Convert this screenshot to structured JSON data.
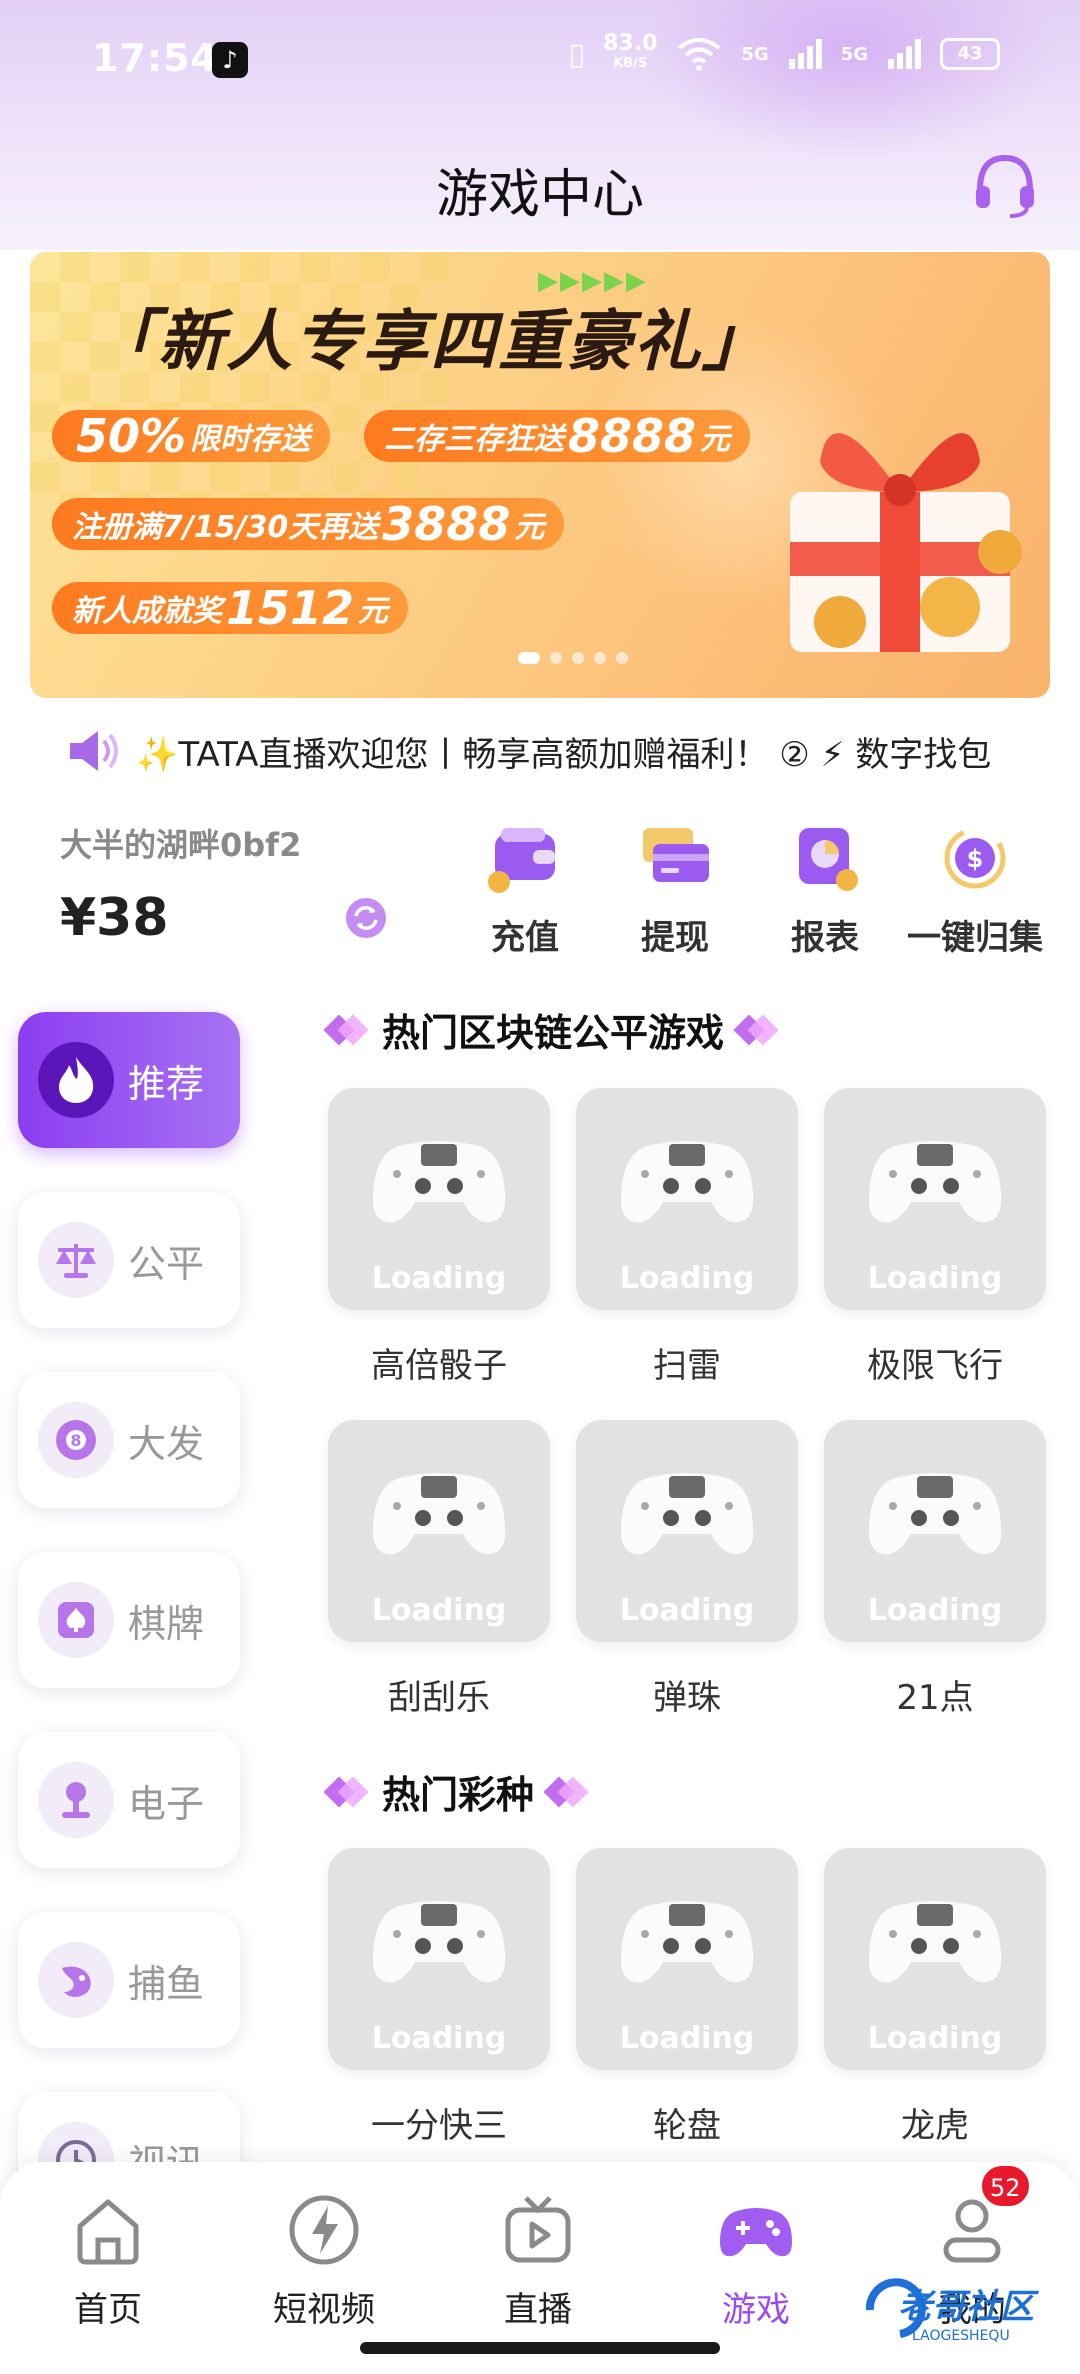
{
  "status_bar": {
    "time": "17:54",
    "net_speed_value": "83.0",
    "net_speed_unit": "KB/S",
    "signal1": "5G",
    "signal2": "5G",
    "battery": "43"
  },
  "header": {
    "title": "游戏中心"
  },
  "banner": {
    "title": "「新人专享四重豪礼」",
    "pill1": {
      "big": "50%",
      "text": "限时存送"
    },
    "pill2": {
      "text": "二存三存狂送",
      "big": "8888",
      "unit": "元"
    },
    "pill3": {
      "text": "注册满7/15/30天再送",
      "big": "3888",
      "unit": "元"
    },
    "pill4": {
      "text": "新人成就奖",
      "big": "1512",
      "unit": "元"
    },
    "page_count": 5,
    "active_page": 1
  },
  "marquee": {
    "text": "✨TATA直播欢迎您丨畅享高额加赠福利！ ② ⚡ 数字找包"
  },
  "wallet": {
    "username": "大半的湖畔0bf2",
    "balance": "¥38"
  },
  "quick_actions": [
    {
      "label": "充值",
      "icon": "wallet-icon"
    },
    {
      "label": "提现",
      "icon": "card-icon"
    },
    {
      "label": "报表",
      "icon": "report-icon"
    },
    {
      "label": "一键归集",
      "icon": "collect-icon"
    }
  ],
  "sidebar": [
    {
      "label": "推荐",
      "icon": "flame-icon",
      "active": true
    },
    {
      "label": "公平",
      "icon": "scale-icon"
    },
    {
      "label": "大发",
      "icon": "ball-8-icon"
    },
    {
      "label": "棋牌",
      "icon": "spade-icon"
    },
    {
      "label": "电子",
      "icon": "joystick-icon"
    },
    {
      "label": "捕鱼",
      "icon": "fish-icon"
    },
    {
      "label": "视讯",
      "icon": "video-icon"
    }
  ],
  "sections": [
    {
      "title": "热门区块链公平游戏",
      "games": [
        {
          "name": "高倍骰子",
          "status": "Loading"
        },
        {
          "name": "扫雷",
          "status": "Loading"
        },
        {
          "name": "极限飞行",
          "status": "Loading"
        },
        {
          "name": "刮刮乐",
          "status": "Loading"
        },
        {
          "name": "弹珠",
          "status": "Loading"
        },
        {
          "name": "21点",
          "status": "Loading"
        }
      ]
    },
    {
      "title": "热门彩种",
      "games": [
        {
          "name": "一分快三",
          "status": "Loading"
        },
        {
          "name": "轮盘",
          "status": "Loading"
        },
        {
          "name": "龙虎",
          "status": "Loading"
        }
      ]
    }
  ],
  "tabbar": {
    "items": [
      {
        "label": "首页",
        "icon": "home-icon"
      },
      {
        "label": "短视频",
        "icon": "lightning-icon"
      },
      {
        "label": "直播",
        "icon": "tv-icon"
      },
      {
        "label": "游戏",
        "icon": "gamepad-icon",
        "active": true
      },
      {
        "label": "我的",
        "icon": "user-icon"
      }
    ],
    "badge": "52"
  },
  "watermark": {
    "text": "老哥社区",
    "sub": "LAOGESHEQU"
  },
  "colors": {
    "accent": "#9b4cf0",
    "banner_orange": "#ff7a1f",
    "badge_red": "#e8192c"
  }
}
